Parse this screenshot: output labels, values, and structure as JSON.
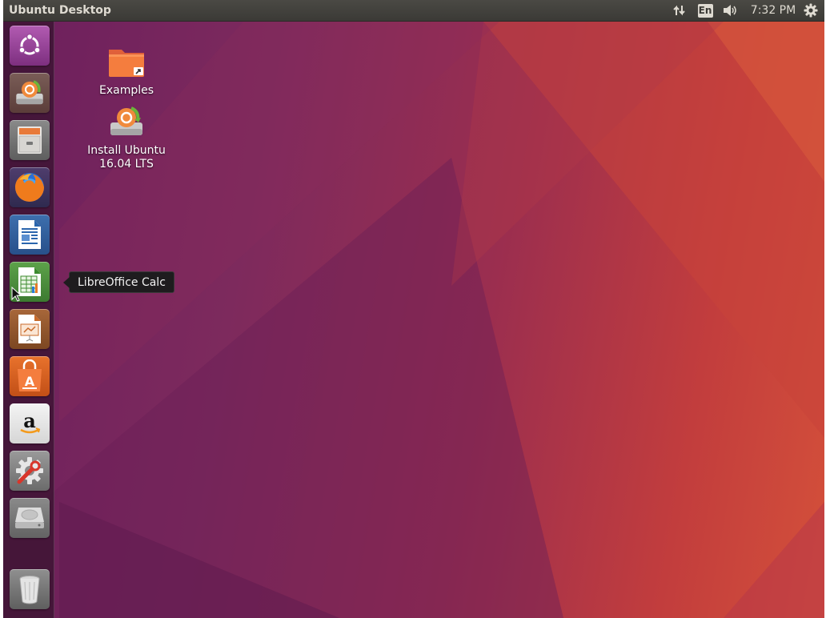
{
  "panel": {
    "title": "Ubuntu Desktop",
    "language": "En",
    "clock": "7:32 PM",
    "indicators": [
      "network-icon",
      "keyboard-language-indicator",
      "volume-icon",
      "clock",
      "system-gear-icon"
    ]
  },
  "launcher": {
    "items": [
      {
        "name": "dash-home",
        "icon": "ubuntu-logo-icon"
      },
      {
        "name": "install-ubuntu",
        "icon": "installer-icon"
      },
      {
        "name": "files",
        "icon": "file-cabinet-icon"
      },
      {
        "name": "firefox",
        "icon": "firefox-icon"
      },
      {
        "name": "libreoffice-writer",
        "icon": "writer-icon"
      },
      {
        "name": "libreoffice-calc",
        "icon": "calc-icon"
      },
      {
        "name": "libreoffice-impress",
        "icon": "impress-icon"
      },
      {
        "name": "ubuntu-software",
        "icon": "software-bag-icon"
      },
      {
        "name": "amazon",
        "icon": "amazon-icon"
      },
      {
        "name": "system-settings",
        "icon": "settings-icon"
      },
      {
        "name": "disk-drive",
        "icon": "hard-drive-icon"
      },
      {
        "name": "trash",
        "icon": "trash-icon"
      }
    ]
  },
  "tooltip": {
    "text": "LibreOffice Calc"
  },
  "desktop": {
    "icons": [
      {
        "label": "Examples",
        "icon": "folder-icon"
      },
      {
        "label_line1": "Install Ubuntu",
        "label_line2": "16.04 LTS",
        "icon": "installer-icon"
      }
    ]
  },
  "colors": {
    "panel": "#3c3b37",
    "wallpaper_start": "#6c1f5d",
    "wallpaper_end": "#d4503a",
    "ubuntu_orange": "#e95420"
  }
}
